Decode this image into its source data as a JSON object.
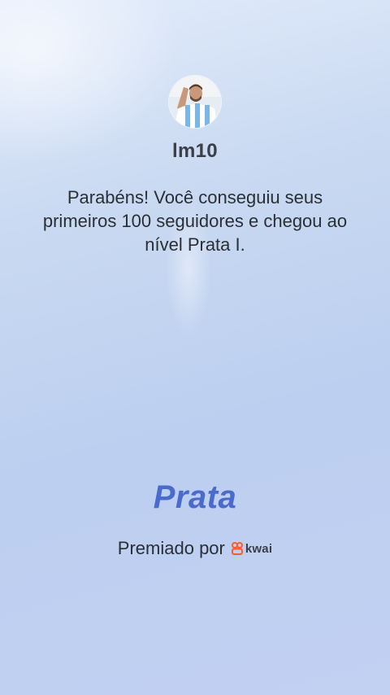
{
  "profile": {
    "username": "lm10",
    "avatar_icon": "user-avatar-photo"
  },
  "message": "Parabéns! Você conseguiu seus primeiros 100 seguidores e chegou ao nível Prata I.",
  "tier": {
    "label": "Prata",
    "color": "#4a6bcc"
  },
  "awarded": {
    "prefix": "Premiado por",
    "brand": "kwai",
    "brand_icon": "kwai-logo-icon",
    "brand_color": "#ff5a2c"
  }
}
